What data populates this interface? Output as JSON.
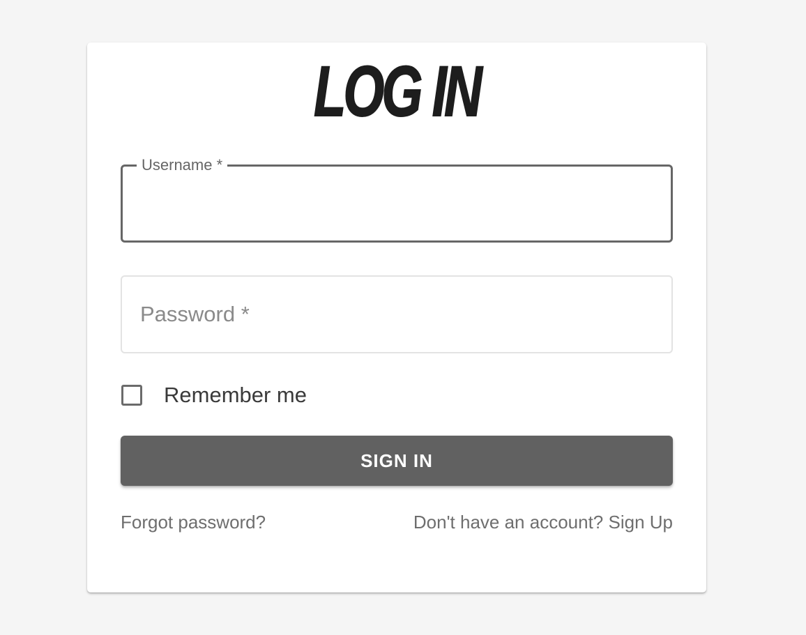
{
  "form": {
    "title": "LOG IN",
    "username": {
      "label": "Username *",
      "value": ""
    },
    "password": {
      "label": "Password *",
      "value": ""
    },
    "remember_me": {
      "label": "Remember me",
      "checked": false
    },
    "submit_label": "SIGN IN",
    "forgot_password_link": "Forgot password?",
    "signup_link": "Don't have an account? Sign Up"
  },
  "colors": {
    "background": "#f5f5f5",
    "card": "#ffffff",
    "button": "#616161",
    "button_text": "#ffffff",
    "title": "#1d1d1d",
    "link": "#6e6e6e"
  }
}
